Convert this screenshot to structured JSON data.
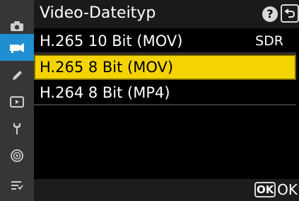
{
  "header": {
    "title": "Video-Dateityp",
    "help_label": "?",
    "back_icon": "return-arrow-icon"
  },
  "sidebar": {
    "items": [
      {
        "icon": "camera-icon"
      },
      {
        "icon": "movie-camera-icon",
        "active": true
      },
      {
        "icon": "pencil-icon"
      },
      {
        "icon": "playback-icon"
      },
      {
        "icon": "wrench-icon"
      },
      {
        "icon": "network-icon"
      },
      {
        "icon": "my-menu-icon"
      }
    ]
  },
  "options": [
    {
      "label": "H.265 10 Bit (MOV)",
      "badge": "SDR",
      "selected": false
    },
    {
      "label": "H.265 8 Bit (MOV)",
      "badge": "",
      "selected": true
    },
    {
      "label": "H.264 8 Bit (MP4)",
      "badge": "",
      "selected": false
    }
  ],
  "footer": {
    "ok_key": "OK",
    "ok_label": "OK"
  },
  "colors": {
    "accent_blue": "#1f8fd1",
    "selection_yellow": "#f4d400",
    "sidebar_bg": "#363636",
    "header_bg": "#1a1a1a"
  }
}
